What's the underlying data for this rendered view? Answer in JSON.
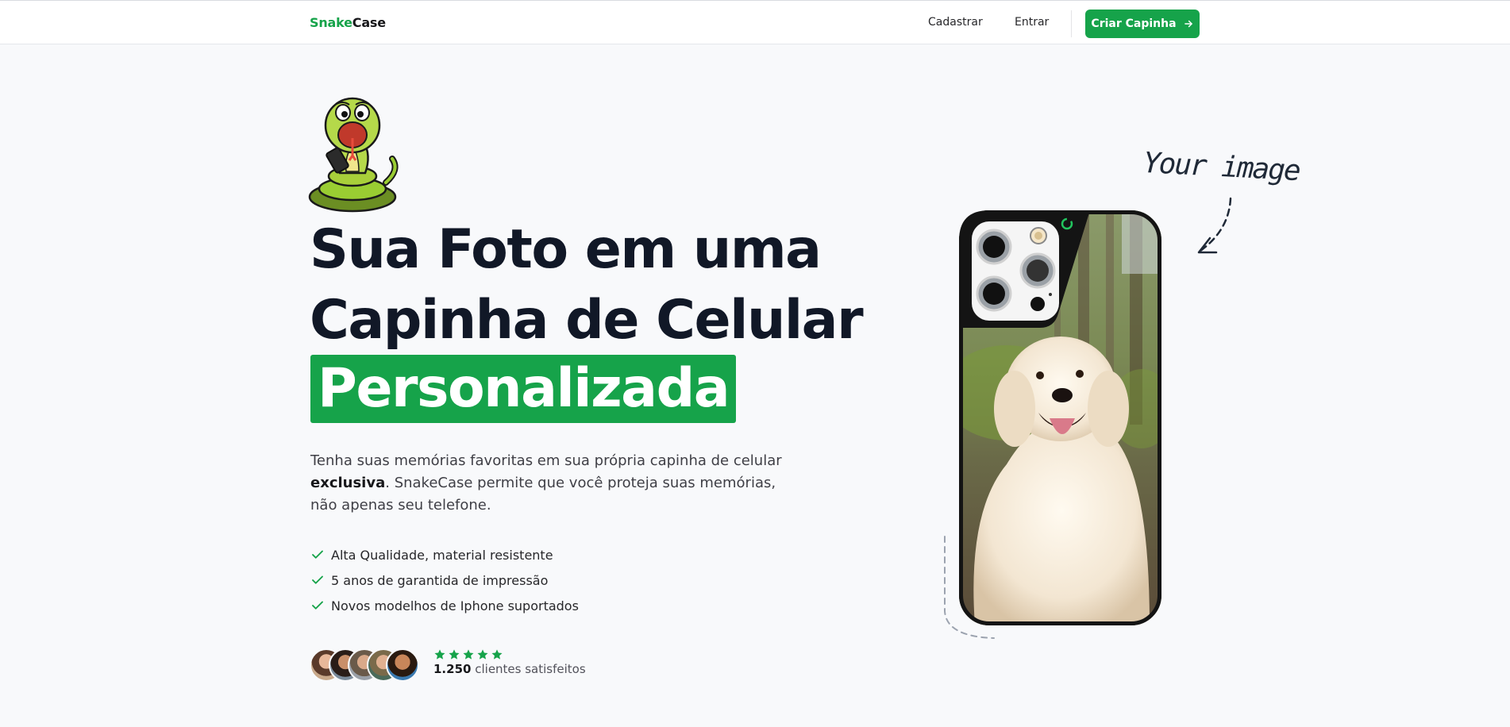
{
  "brand": {
    "name_part1": "Snake",
    "name_part2": "Case"
  },
  "nav": {
    "signup_label": "Cadastrar",
    "login_label": "Entrar",
    "cta_label": "Criar Capinha"
  },
  "hero": {
    "title_line1": "Sua Foto em uma",
    "title_line2": "Capinha de Celular",
    "title_highlight": "Personalizada",
    "description_part1": "Tenha suas memórias favoritas em sua própria capinha de celular ",
    "description_bold": "exclusiva",
    "description_part2": ". SnakeCase permite que você proteja suas memórias, não apenas seu telefone.",
    "features": [
      "Alta Qualidade, material resistente",
      "5 anos de garantida de impressão",
      "Novos modelhos de Iphone suportados"
    ],
    "rating": {
      "stars": 5,
      "count": "1.250",
      "label": "clientes satisfeitos"
    }
  },
  "preview": {
    "annotation": "Your image"
  },
  "colors": {
    "accent": "#16a34a",
    "text_dark": "#111827",
    "background": "#f8f9fb"
  },
  "icons": [
    "arrow-right-icon",
    "check-icon",
    "star-icon",
    "snake-mascot",
    "phone-camera"
  ]
}
